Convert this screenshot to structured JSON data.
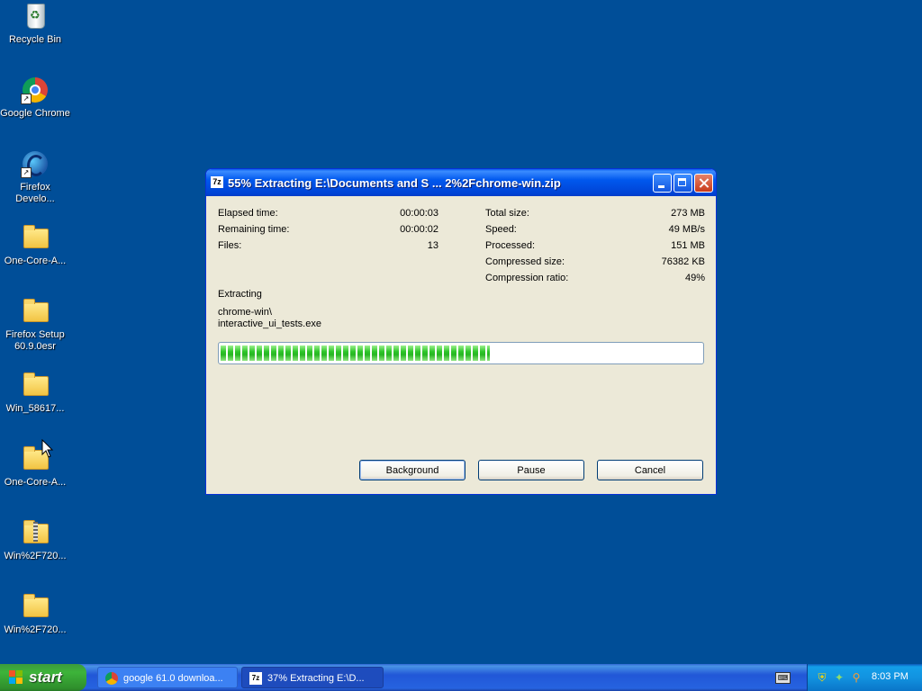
{
  "desktop": {
    "icons": [
      {
        "label": "Recycle Bin"
      },
      {
        "label": "Google Chrome"
      },
      {
        "label": "Firefox Develo..."
      },
      {
        "label": "One-Core-A..."
      },
      {
        "label": "Firefox Setup 60.9.0esr"
      },
      {
        "label": "Win_58617..."
      },
      {
        "label": "One-Core-A..."
      },
      {
        "label": "Win%2F720..."
      },
      {
        "label": "Win%2F720..."
      }
    ]
  },
  "dialog": {
    "app_icon": "7z",
    "title": "55% Extracting E:\\Documents and S ... 2%2Fchrome-win.zip",
    "left_stats": [
      {
        "label": "Elapsed time:",
        "value": "00:00:03"
      },
      {
        "label": "Remaining time:",
        "value": "00:00:02"
      },
      {
        "label": "Files:",
        "value": "13"
      }
    ],
    "right_stats": [
      {
        "label": "Total size:",
        "value": "273 MB"
      },
      {
        "label": "Speed:",
        "value": "49 MB/s"
      },
      {
        "label": "Processed:",
        "value": "151 MB"
      },
      {
        "label": "Compressed size:",
        "value": "76382 KB"
      },
      {
        "label": "Compression ratio:",
        "value": "49%"
      }
    ],
    "status": "Extracting",
    "path_line1": "chrome-win\\",
    "path_line2": "interactive_ui_tests.exe",
    "progress_fraction": 0.56,
    "buttons": {
      "background": "Background",
      "pause": "Pause",
      "cancel": "Cancel"
    }
  },
  "taskbar": {
    "start_label": "start",
    "tasks": [
      {
        "label": "google 61.0 downloa...",
        "icon": "chrome-icon"
      },
      {
        "label": "37% Extracting E:\\D...",
        "icon": "7zip-icon"
      }
    ],
    "clock": "8:03 PM"
  }
}
